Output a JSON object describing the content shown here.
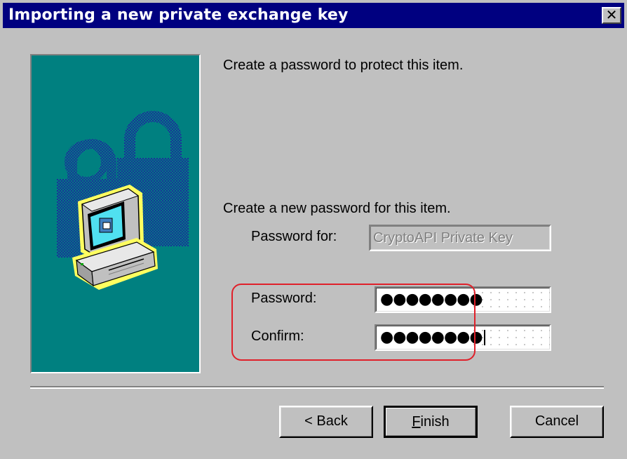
{
  "window": {
    "title": "Importing a new private exchange key",
    "close_glyph": "✕"
  },
  "content": {
    "heading": "Create a password to protect this item.",
    "subheading": "Create a new password for this item.",
    "password_for_label": "Password for:",
    "password_for_value": "CryptoAPI Private Key",
    "password_label": "Password:",
    "password_mask": "●●●●●●●●",
    "confirm_label": "Confirm:",
    "confirm_mask": "●●●●●●●●"
  },
  "buttons": {
    "back": "< Back",
    "finish_mnemonic": "F",
    "finish_rest": "inish",
    "cancel": "Cancel"
  },
  "colors": {
    "titlebar": "#000080",
    "banner": "#008080",
    "annotation": "#e0202a"
  },
  "icons": {
    "banner_art": "padlock-computer-icon",
    "close": "close-icon"
  }
}
